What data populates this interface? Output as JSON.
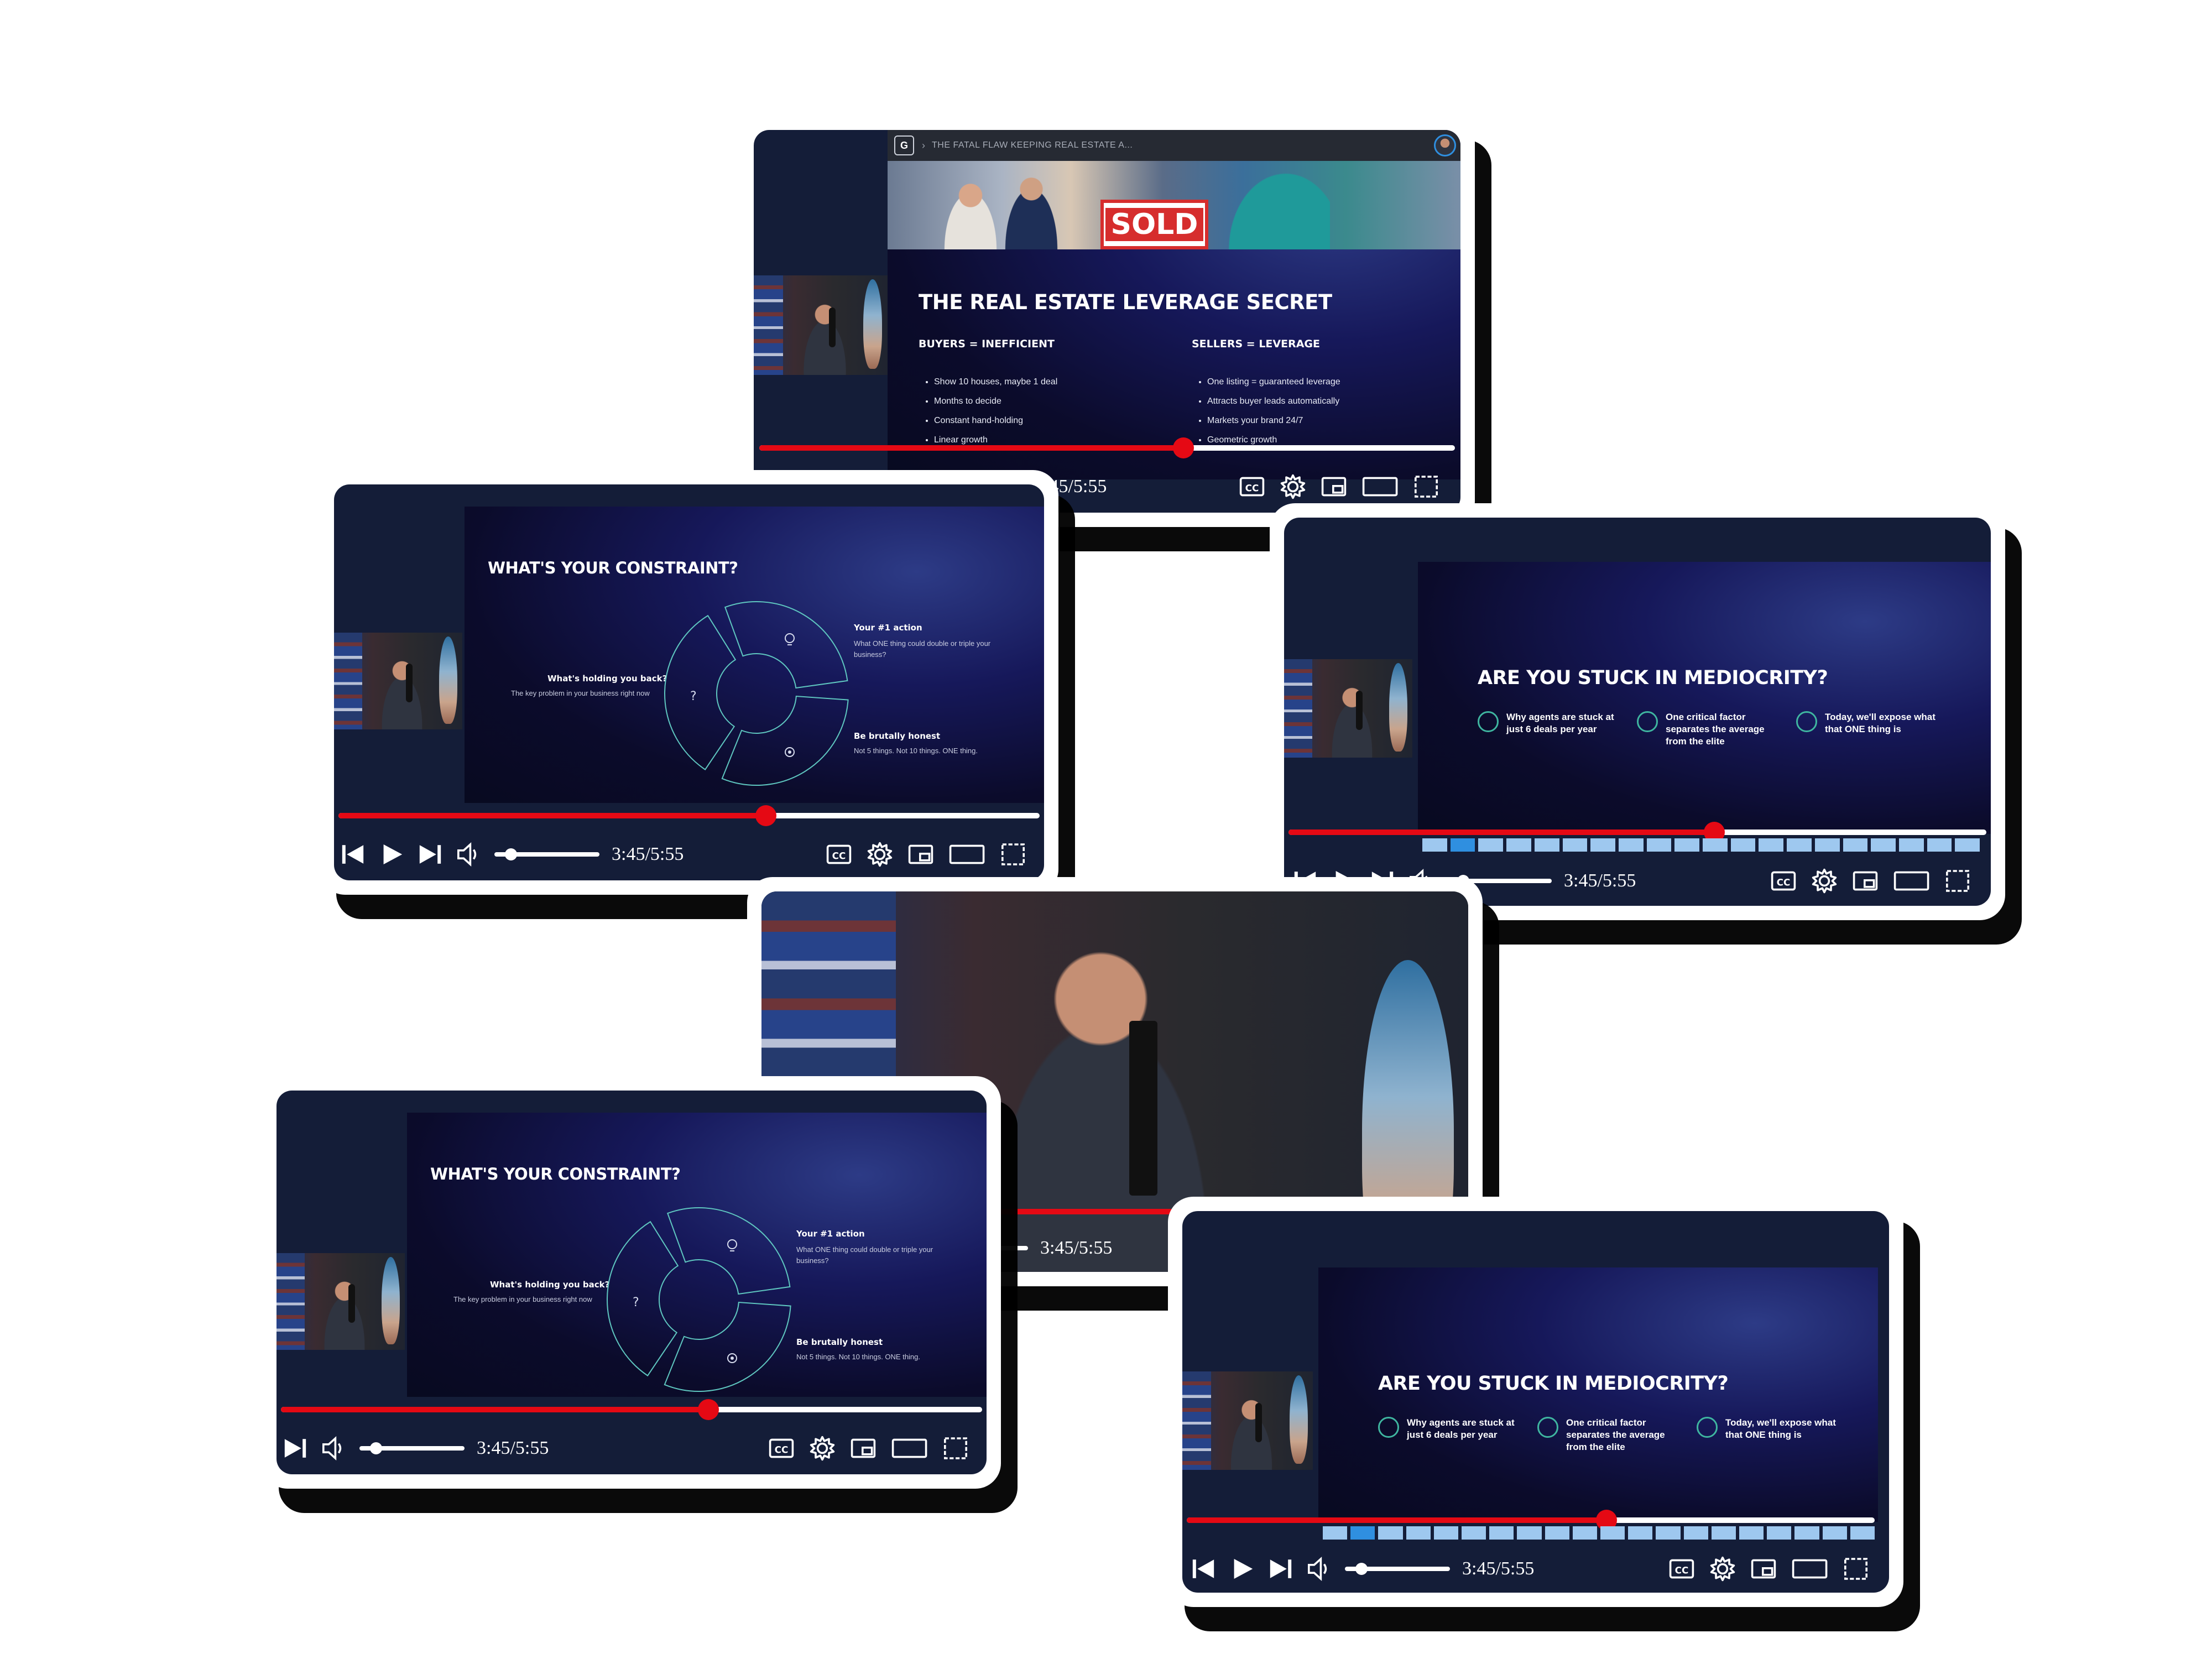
{
  "controls": {
    "time": "3:45/5:55",
    "progress_fraction": 0.61,
    "icons": [
      "skip-back-icon",
      "play-icon",
      "skip-forward-icon",
      "volume-icon",
      "captions-icon",
      "settings-gear-icon",
      "miniplayer-icon",
      "theater-mode-icon",
      "fullscreen-icon"
    ]
  },
  "slides": {
    "leverage": {
      "breadcrumb_logo": "G",
      "breadcrumb": "THE FATAL FLAW KEEPING REAL ESTATE A...",
      "sign_text": "SOLD",
      "title": "THE REAL ESTATE LEVERAGE SECRET",
      "buyers": {
        "heading": "BUYERS = INEFFICIENT",
        "items": [
          "Show 10 houses, maybe 1 deal",
          "Months to decide",
          "Constant hand-holding",
          "Linear growth"
        ]
      },
      "sellers": {
        "heading": "SELLERS = LEVERAGE",
        "items": [
          "One listing = guaranteed leverage",
          "Attracts buyer leads automatically",
          "Markets your brand 24/7",
          "Geometric growth"
        ]
      }
    },
    "constraint": {
      "title": "WHAT'S YOUR CONSTRAINT?",
      "left_heading": "What's holding you back?",
      "left_sub": "The key problem in your business right now",
      "right_top_heading": "Your #1 action",
      "right_top_sub": "What ONE thing could double or triple your business?",
      "right_bottom_heading": "Be brutally honest",
      "right_bottom_sub": "Not 5 things. Not 10 things. ONE thing.",
      "question_mark": "?"
    },
    "mediocrity": {
      "title": "ARE YOU STUCK IN MEDIOCRITY?",
      "options": [
        "Why agents are stuck at just 6 deals per year",
        "One critical factor separates the average from the elite",
        "Today, we'll expose what that ONE thing is"
      ]
    }
  },
  "colors": {
    "accent_red": "#e50914",
    "chapter_blue": "#9ec8ef",
    "teal_ring": "#3fb6a0",
    "player_bg": "#141d38"
  }
}
